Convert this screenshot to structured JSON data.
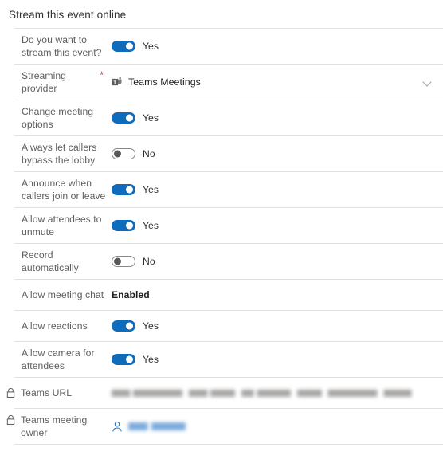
{
  "section": {
    "title": "Stream this event online"
  },
  "rows": [
    {
      "label": "Do you want to stream this event?",
      "type": "toggle",
      "state": "on",
      "state_label": "Yes",
      "required": false
    },
    {
      "label": "Streaming provider",
      "type": "dropdown",
      "value": "Teams Meetings",
      "icon": "teams-icon",
      "required": true,
      "required_marker": "*",
      "chevron": "chevron-down-icon"
    },
    {
      "label": "Change meeting options",
      "type": "toggle",
      "state": "on",
      "state_label": "Yes",
      "required": false
    },
    {
      "label": "Always let callers bypass the lobby",
      "type": "toggle",
      "state": "off",
      "state_label": "No",
      "required": false
    },
    {
      "label": "Announce when callers join or leave",
      "type": "toggle",
      "state": "on",
      "state_label": "Yes",
      "required": false
    },
    {
      "label": "Allow attendees to unmute",
      "type": "toggle",
      "state": "on",
      "state_label": "Yes",
      "required": false
    },
    {
      "label": "Record automatically",
      "type": "toggle",
      "state": "off",
      "state_label": "No",
      "required": false
    },
    {
      "label": "Allow meeting chat",
      "type": "text",
      "value": "Enabled",
      "required": false
    },
    {
      "label": "Allow reactions",
      "type": "toggle",
      "state": "on",
      "state_label": "Yes",
      "required": false
    },
    {
      "label": "Allow camera for attendees",
      "type": "toggle",
      "state": "on",
      "state_label": "Yes",
      "required": false
    },
    {
      "label": "Teams URL",
      "type": "redacted-url",
      "value": "",
      "locked": true,
      "lock_icon": "lock-icon"
    },
    {
      "label": "Teams meeting owner",
      "type": "redacted-person",
      "value": "",
      "locked": true,
      "lock_icon": "lock-icon",
      "person_icon": "person-icon"
    }
  ],
  "colors": {
    "toggle_on": "#0f6cbd",
    "toggle_off_border": "#8a8886",
    "required_asterisk": "#a4262c",
    "label_text": "#605e5c",
    "value_text": "#201f1e",
    "divider": "#e1e1e1",
    "link": "#0f6cbd"
  }
}
